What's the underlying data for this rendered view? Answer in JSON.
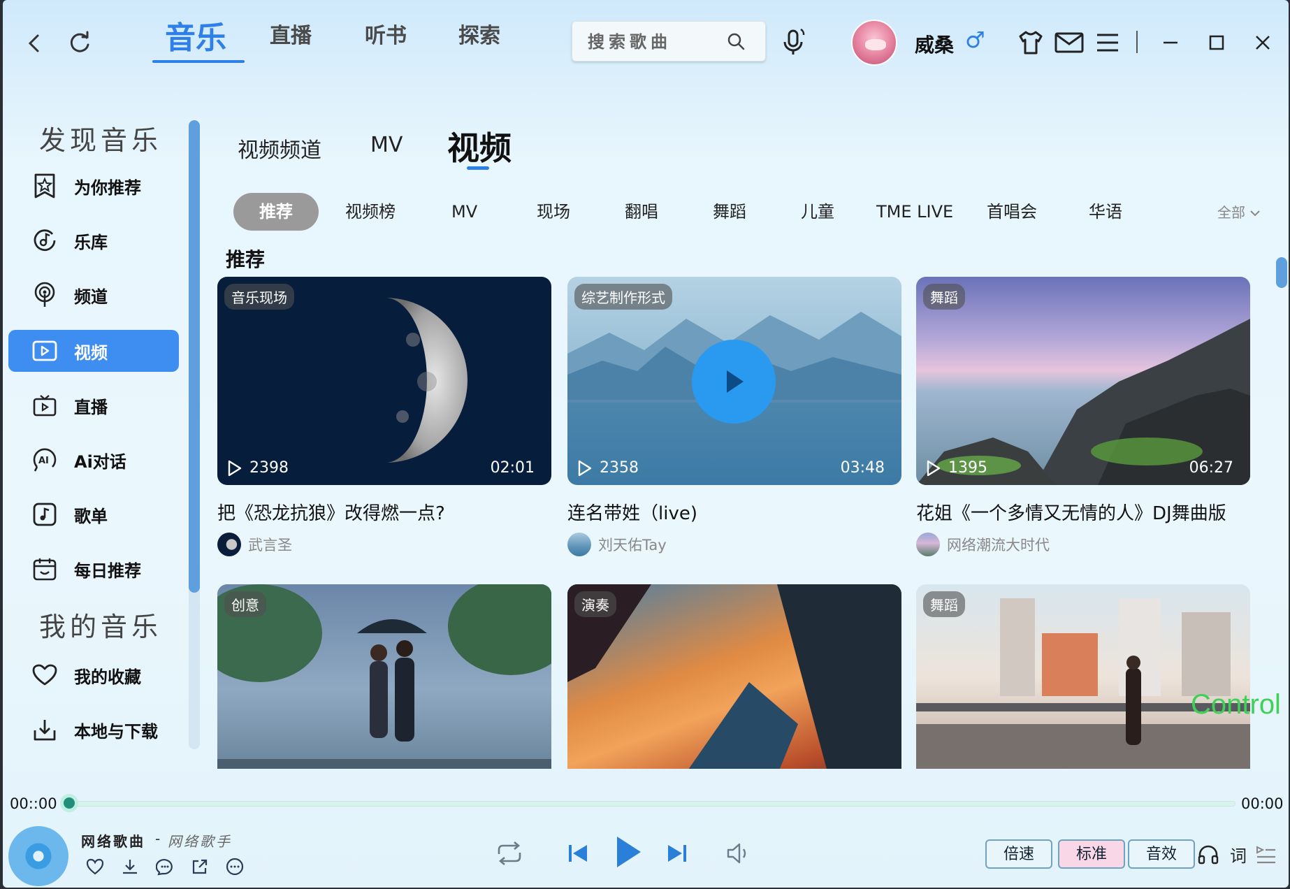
{
  "topbar": {
    "main_tabs": [
      {
        "label": "音乐",
        "active": true
      },
      {
        "label": "直播"
      },
      {
        "label": "听书"
      },
      {
        "label": "探索"
      }
    ],
    "search_placeholder": "搜索歌曲",
    "username": "威桑",
    "gender_symbol": "♂",
    "accent_color": "#2f7fe8"
  },
  "sidebar": {
    "sections": [
      {
        "title": "发现音乐"
      },
      {
        "title": "我的音乐"
      }
    ],
    "items": [
      {
        "label": "为你推荐",
        "icon": "star-badge-icon"
      },
      {
        "label": "乐库",
        "icon": "music-disc-icon"
      },
      {
        "label": "频道",
        "icon": "broadcast-icon"
      },
      {
        "label": "视频",
        "icon": "video-play-icon",
        "active": true
      },
      {
        "label": "直播",
        "icon": "tv-icon"
      },
      {
        "label": "Ai对话",
        "icon": "ai-chat-icon"
      },
      {
        "label": "歌单",
        "icon": "music-note-icon"
      },
      {
        "label": "每日推荐",
        "icon": "calendar-icon"
      },
      {
        "label": "我的收藏",
        "icon": "heart-icon"
      },
      {
        "label": "本地与下载",
        "icon": "download-icon"
      }
    ]
  },
  "content": {
    "subtabs": [
      {
        "label": "视频频道"
      },
      {
        "label": "MV"
      },
      {
        "label": "视频",
        "active": true
      }
    ],
    "chips": [
      "推荐",
      "视频榜",
      "MV",
      "现场",
      "翻唱",
      "舞蹈",
      "儿童",
      "TME LIVE",
      "首唱会",
      "华语"
    ],
    "chip_all": "全部",
    "section_title": "推荐",
    "cards": [
      {
        "tag": "音乐现场",
        "plays": "2398",
        "duration": "02:01",
        "title": "把《恐龙抗狼》改得燃一点?",
        "author": "武言圣"
      },
      {
        "tag": "综艺制作形式",
        "plays": "2358",
        "duration": "03:48",
        "title": "连名带姓（live)",
        "author": "刘天佑Tay"
      },
      {
        "tag": "舞蹈",
        "plays": "1395",
        "duration": "06:27",
        "title": "花姐《一个多情又无情的人》DJ舞曲版",
        "author": "网络潮流大时代"
      },
      {
        "tag": "创意"
      },
      {
        "tag": "演奏"
      },
      {
        "tag": "舞蹈"
      }
    ],
    "overlay_text": "Control"
  },
  "player": {
    "time_current": "00::00",
    "time_total": "00:00",
    "progress": 0.0,
    "song_name": "网络歌曲",
    "separator": "-",
    "artist": "网络歌手",
    "pills": [
      {
        "label": "倍速"
      },
      {
        "label": "标准",
        "active": true
      },
      {
        "label": "音效"
      }
    ],
    "lyrics_label": "词"
  }
}
